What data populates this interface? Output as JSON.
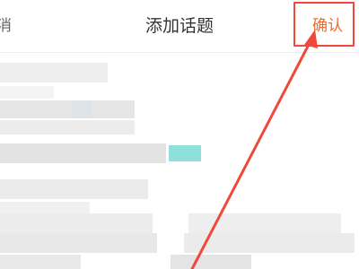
{
  "header": {
    "cancel_label": "消",
    "title": "添加话题",
    "confirm_label": "确认"
  },
  "annotation": {
    "color": "#f0493b"
  },
  "colors": {
    "accent": "#f26a2b",
    "teal_tag": "#8fe0dc"
  }
}
